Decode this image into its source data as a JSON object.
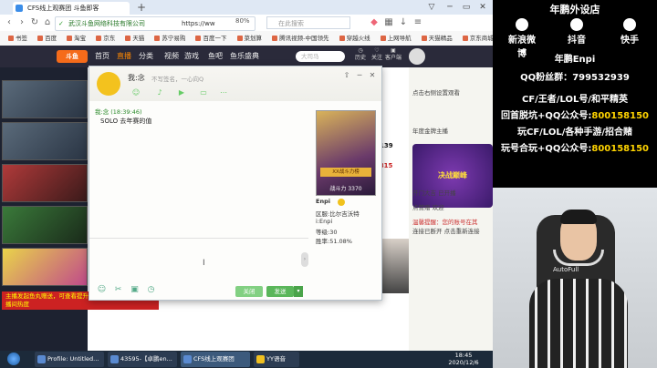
{
  "browser": {
    "tab_title": "CFS线上观赛团 斗鱼即客",
    "new_tab": "+",
    "window_controls": [
      "▽",
      "─",
      "▭",
      "✕"
    ],
    "url_site": "武汉斗鱼网络科技有限公司",
    "url": "https://ww",
    "zoom": "80%",
    "search_placeholder": "在此搜索",
    "bookmarks": [
      "书签",
      "百度",
      "淘宝",
      "京东",
      "天猫",
      "苏宁易购",
      "百度一下",
      "菜划算",
      "腾讯视频-中国领先",
      "穿越火线",
      "上网导航",
      "天猫精品",
      "京东商城"
    ]
  },
  "site": {
    "logo": "斗鱼",
    "nav": [
      "首页",
      "直播",
      "分类",
      "视频",
      "游戏",
      "鱼吧",
      "鱼乐盛典"
    ],
    "search": "大司马",
    "icons": [
      "历史",
      "关注",
      "客户端"
    ],
    "banner": "主播发起鱼丸赠送，可查看提升 用户观看时长开播后直播间热度",
    "right_chat": [
      "点击右侧设置观看",
      "年度金牌主播",
      "开门大吉 已开播",
      "点赞赠 欢迎",
      "温馨提醒：您的账号在其",
      "连接已断开 点击重新连接"
    ],
    "gift": "决战巅峰",
    "chat_count": "139",
    "chat_count2": "15815"
  },
  "dialog": {
    "name": "我:念",
    "signature": "不写签名，一心向Q",
    "sender": "我:念 (18:39:46)",
    "message": "SOLO 去年赛的值",
    "close_label": "关闭",
    "send_label": "发送",
    "profile": {
      "badge": "XX战斗力榜",
      "power": "战斗力 3370",
      "name": "Enpi",
      "region": "区服:比尔吉沃特",
      "id": "i:Enpi",
      "level": "等级:30",
      "winrate": "胜率:51.08%"
    }
  },
  "taskbar": {
    "tasks": [
      "Profile: Untitled...",
      "43595-【卓鹏en...",
      "CFS线上观赛团",
      "YY语音"
    ],
    "time": "18:45",
    "date": "2020/12/6"
  },
  "panel": {
    "title": "年鹏外设店",
    "socials": [
      {
        "name": "新浪微博"
      },
      {
        "name": "抖音"
      },
      {
        "name": "快手"
      }
    ],
    "lines": [
      {
        "text": "年鹏Enpi",
        "hi": ""
      },
      {
        "text": "QQ粉丝群：",
        "hi": "799532939"
      },
      {
        "text": "CF/王者/LOL号/和平精英",
        "hi": ""
      },
      {
        "text": "回首脱坑+QQ公众号:",
        "hi": "800158150"
      },
      {
        "text": "玩CF/LOL/各种手游/招合赌",
        "hi": ""
      },
      {
        "text": "玩号合玩+QQ公众号:",
        "hi": "800158150"
      }
    ],
    "cam_brand": "AutoFull"
  },
  "colors": {
    "accent": "#5ab65a",
    "brand": "#f56b1a",
    "panel_highlight": "#ffd400"
  }
}
